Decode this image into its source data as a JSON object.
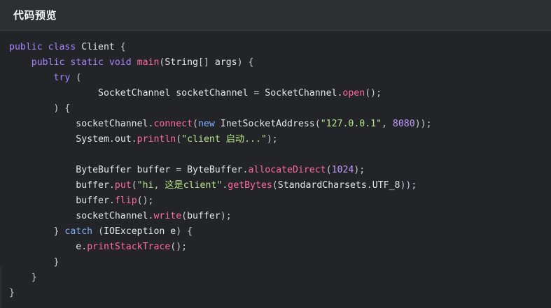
{
  "header": {
    "title": "代码预览"
  },
  "code": {
    "lines": [
      [
        [
          "kw",
          "public "
        ],
        [
          "kw",
          "class "
        ],
        [
          "ty",
          "Client "
        ],
        [
          "punc",
          "{"
        ]
      ],
      [
        [
          "pl",
          "    "
        ],
        [
          "kw",
          "public "
        ],
        [
          "kw",
          "static "
        ],
        [
          "kw",
          "void "
        ],
        [
          "fn",
          "main"
        ],
        [
          "punc",
          "("
        ],
        [
          "ty",
          "String"
        ],
        [
          "punc",
          "[] "
        ],
        [
          "pl",
          "args"
        ],
        [
          "punc",
          ") {"
        ]
      ],
      [
        [
          "pl",
          "        "
        ],
        [
          "kw",
          "try "
        ],
        [
          "punc",
          "("
        ]
      ],
      [
        [
          "pl",
          "                "
        ],
        [
          "ty",
          "SocketChannel "
        ],
        [
          "pl",
          "socketChannel "
        ],
        [
          "punc",
          "= "
        ],
        [
          "ty",
          "SocketChannel"
        ],
        [
          "punc",
          "."
        ],
        [
          "fn",
          "open"
        ],
        [
          "punc",
          "();"
        ]
      ],
      [
        [
          "pl",
          "        "
        ],
        [
          "punc",
          ") {"
        ]
      ],
      [
        [
          "pl",
          "            "
        ],
        [
          "pl",
          "socketChannel"
        ],
        [
          "punc",
          "."
        ],
        [
          "fn",
          "connect"
        ],
        [
          "punc",
          "("
        ],
        [
          "kw2",
          "new "
        ],
        [
          "ty",
          "InetSocketAddress"
        ],
        [
          "punc",
          "("
        ],
        [
          "str",
          "\"127.0.0.1\""
        ],
        [
          "punc",
          ", "
        ],
        [
          "num",
          "8080"
        ],
        [
          "punc",
          "));"
        ]
      ],
      [
        [
          "pl",
          "            "
        ],
        [
          "ty",
          "System"
        ],
        [
          "punc",
          "."
        ],
        [
          "pl",
          "out"
        ],
        [
          "punc",
          "."
        ],
        [
          "fn",
          "println"
        ],
        [
          "punc",
          "("
        ],
        [
          "str",
          "\"client 启动...\""
        ],
        [
          "punc",
          ");"
        ]
      ],
      [],
      [
        [
          "pl",
          "            "
        ],
        [
          "ty",
          "ByteBuffer "
        ],
        [
          "pl",
          "buffer "
        ],
        [
          "punc",
          "= "
        ],
        [
          "ty",
          "ByteBuffer"
        ],
        [
          "punc",
          "."
        ],
        [
          "fn",
          "allocateDirect"
        ],
        [
          "punc",
          "("
        ],
        [
          "num",
          "1024"
        ],
        [
          "punc",
          ");"
        ]
      ],
      [
        [
          "pl",
          "            "
        ],
        [
          "pl",
          "buffer"
        ],
        [
          "punc",
          "."
        ],
        [
          "fn",
          "put"
        ],
        [
          "punc",
          "("
        ],
        [
          "str",
          "\"hi, 这是client\""
        ],
        [
          "punc",
          "."
        ],
        [
          "fn",
          "getBytes"
        ],
        [
          "punc",
          "("
        ],
        [
          "ty",
          "StandardCharsets"
        ],
        [
          "punc",
          "."
        ],
        [
          "pl",
          "UTF_8"
        ],
        [
          "punc",
          "));"
        ]
      ],
      [
        [
          "pl",
          "            "
        ],
        [
          "pl",
          "buffer"
        ],
        [
          "punc",
          "."
        ],
        [
          "fn",
          "flip"
        ],
        [
          "punc",
          "();"
        ]
      ],
      [
        [
          "pl",
          "            "
        ],
        [
          "pl",
          "socketChannel"
        ],
        [
          "punc",
          "."
        ],
        [
          "fn",
          "write"
        ],
        [
          "punc",
          "("
        ],
        [
          "pl",
          "buffer"
        ],
        [
          "punc",
          ");"
        ]
      ],
      [
        [
          "pl",
          "        "
        ],
        [
          "punc",
          "} "
        ],
        [
          "kw2",
          "catch "
        ],
        [
          "punc",
          "("
        ],
        [
          "ty",
          "IOException "
        ],
        [
          "pl",
          "e"
        ],
        [
          "punc",
          ") {"
        ]
      ],
      [
        [
          "pl",
          "            "
        ],
        [
          "pl",
          "e"
        ],
        [
          "punc",
          "."
        ],
        [
          "fn",
          "printStackTrace"
        ],
        [
          "punc",
          "();"
        ]
      ],
      [
        [
          "pl",
          "        "
        ],
        [
          "punc",
          "}"
        ]
      ],
      [
        [
          "pl",
          "    "
        ],
        [
          "punc",
          "}"
        ]
      ],
      [
        [
          "punc",
          "}"
        ]
      ]
    ]
  }
}
